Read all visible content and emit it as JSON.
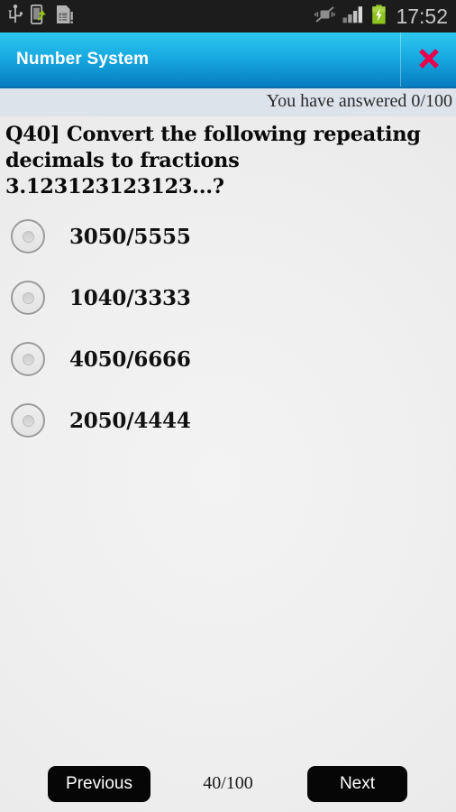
{
  "status_bar": {
    "icons_left": [
      "usb-icon",
      "phone-transfer-icon",
      "sim-card-alert-icon"
    ],
    "icons_right": [
      "vibrate-off-icon",
      "signal-bars-icon",
      "battery-charging-icon"
    ],
    "time": "17:52",
    "background_color": "#1c1c1c",
    "battery_color": "#8dc21f"
  },
  "title_bar": {
    "title": "Number System",
    "close_icon": "close-x-icon",
    "close_color": "#e8004c",
    "gradient_top": "#2ec8ef",
    "gradient_bottom": "#0579bd"
  },
  "answered_bar": {
    "text": "You have answered 0/100",
    "answered_count": 0,
    "total_questions": 100,
    "background_color": "#dde3ea"
  },
  "question": {
    "text": "Q40]  Convert the following repeating decimals to fractions 3.123123123123...?",
    "number": 40
  },
  "options": [
    {
      "label": "3050/5555",
      "selected": false,
      "radio_icon": "radio-unchecked-icon"
    },
    {
      "label": "1040/3333",
      "selected": false,
      "radio_icon": "radio-unchecked-icon"
    },
    {
      "label": "4050/6666",
      "selected": false,
      "radio_icon": "radio-unchecked-icon"
    },
    {
      "label": "2050/4444",
      "selected": false,
      "radio_icon": "radio-unchecked-icon"
    }
  ],
  "footer": {
    "previous_label": "Previous",
    "next_label": "Next",
    "counter": "40/100",
    "current_question": 40,
    "total_questions": 100,
    "button_color": "#060606"
  }
}
